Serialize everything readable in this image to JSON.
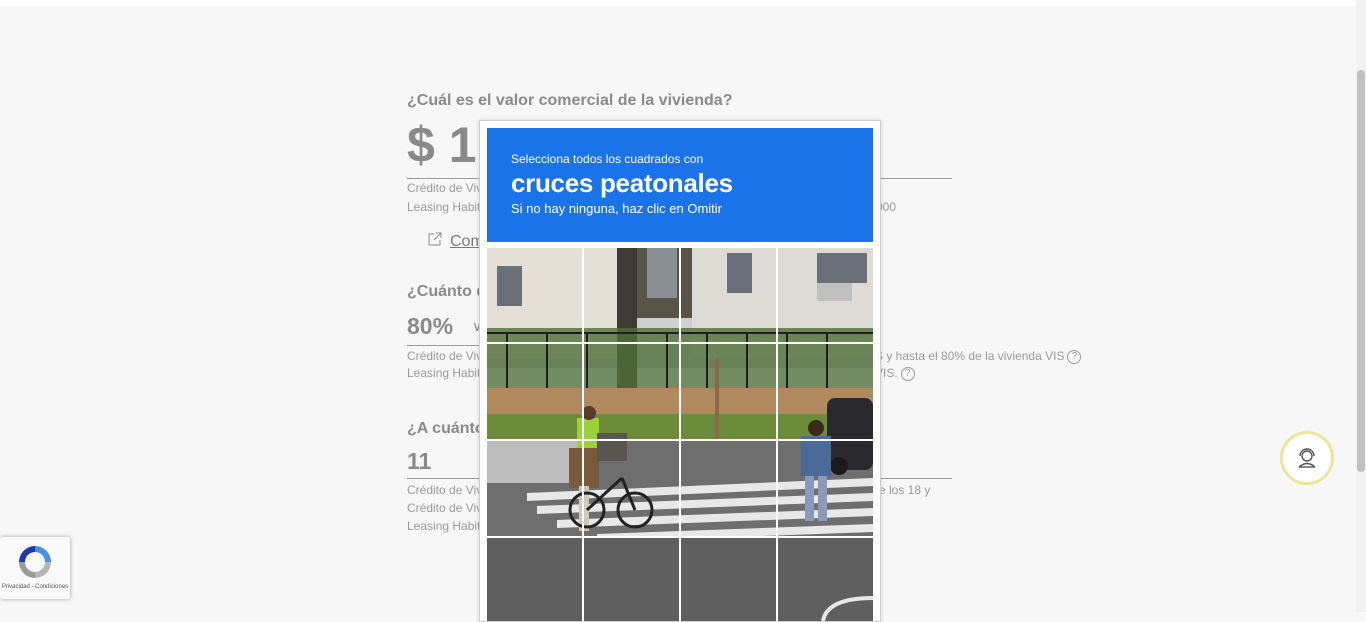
{
  "form": {
    "q1": "¿Cuál es el valor comercial de la vivienda?",
    "q1_value": "$ 1",
    "q1_note1": "Crédito de Viv",
    "q1_note2": "Leasing Habit",
    "q1_note2_tail": "000",
    "q1_link": "Com",
    "q2": "¿Cuánto d",
    "q2_value": "80%",
    "q2_note1": "Crédito de Viv",
    "q2_note1_tail": "S y hasta el 80% de la vivienda VIS",
    "q2_note2": "Leasing Habit",
    "q2_note2_tail": "VIS.",
    "q3": "¿A cuánto",
    "q3_value": "11",
    "q3_note1": "Crédito de Viv",
    "q3_note1_tail": "re los 18 y",
    "q3_note2": "Crédito de Viv",
    "q3_note3": "Leasing Habit"
  },
  "captcha": {
    "instruction": "Selecciona todos los cuadrados con",
    "target": "cruces peatonales",
    "hint": "Si no hay ninguna, haz clic en Omitir",
    "grid_rows": 4,
    "grid_cols": 4
  },
  "recaptcha_badge": {
    "terms": "Privacidad - Condiciones"
  },
  "icons": {
    "external_link": "external-link-icon",
    "help": "help-icon",
    "chevron": "chevron-down-icon",
    "support_agent": "support-agent-icon",
    "recaptcha_logo": "recaptcha-logo-icon"
  },
  "colors": {
    "captcha_header": "#1a73e8",
    "chat_ring": "#f0e39a"
  }
}
